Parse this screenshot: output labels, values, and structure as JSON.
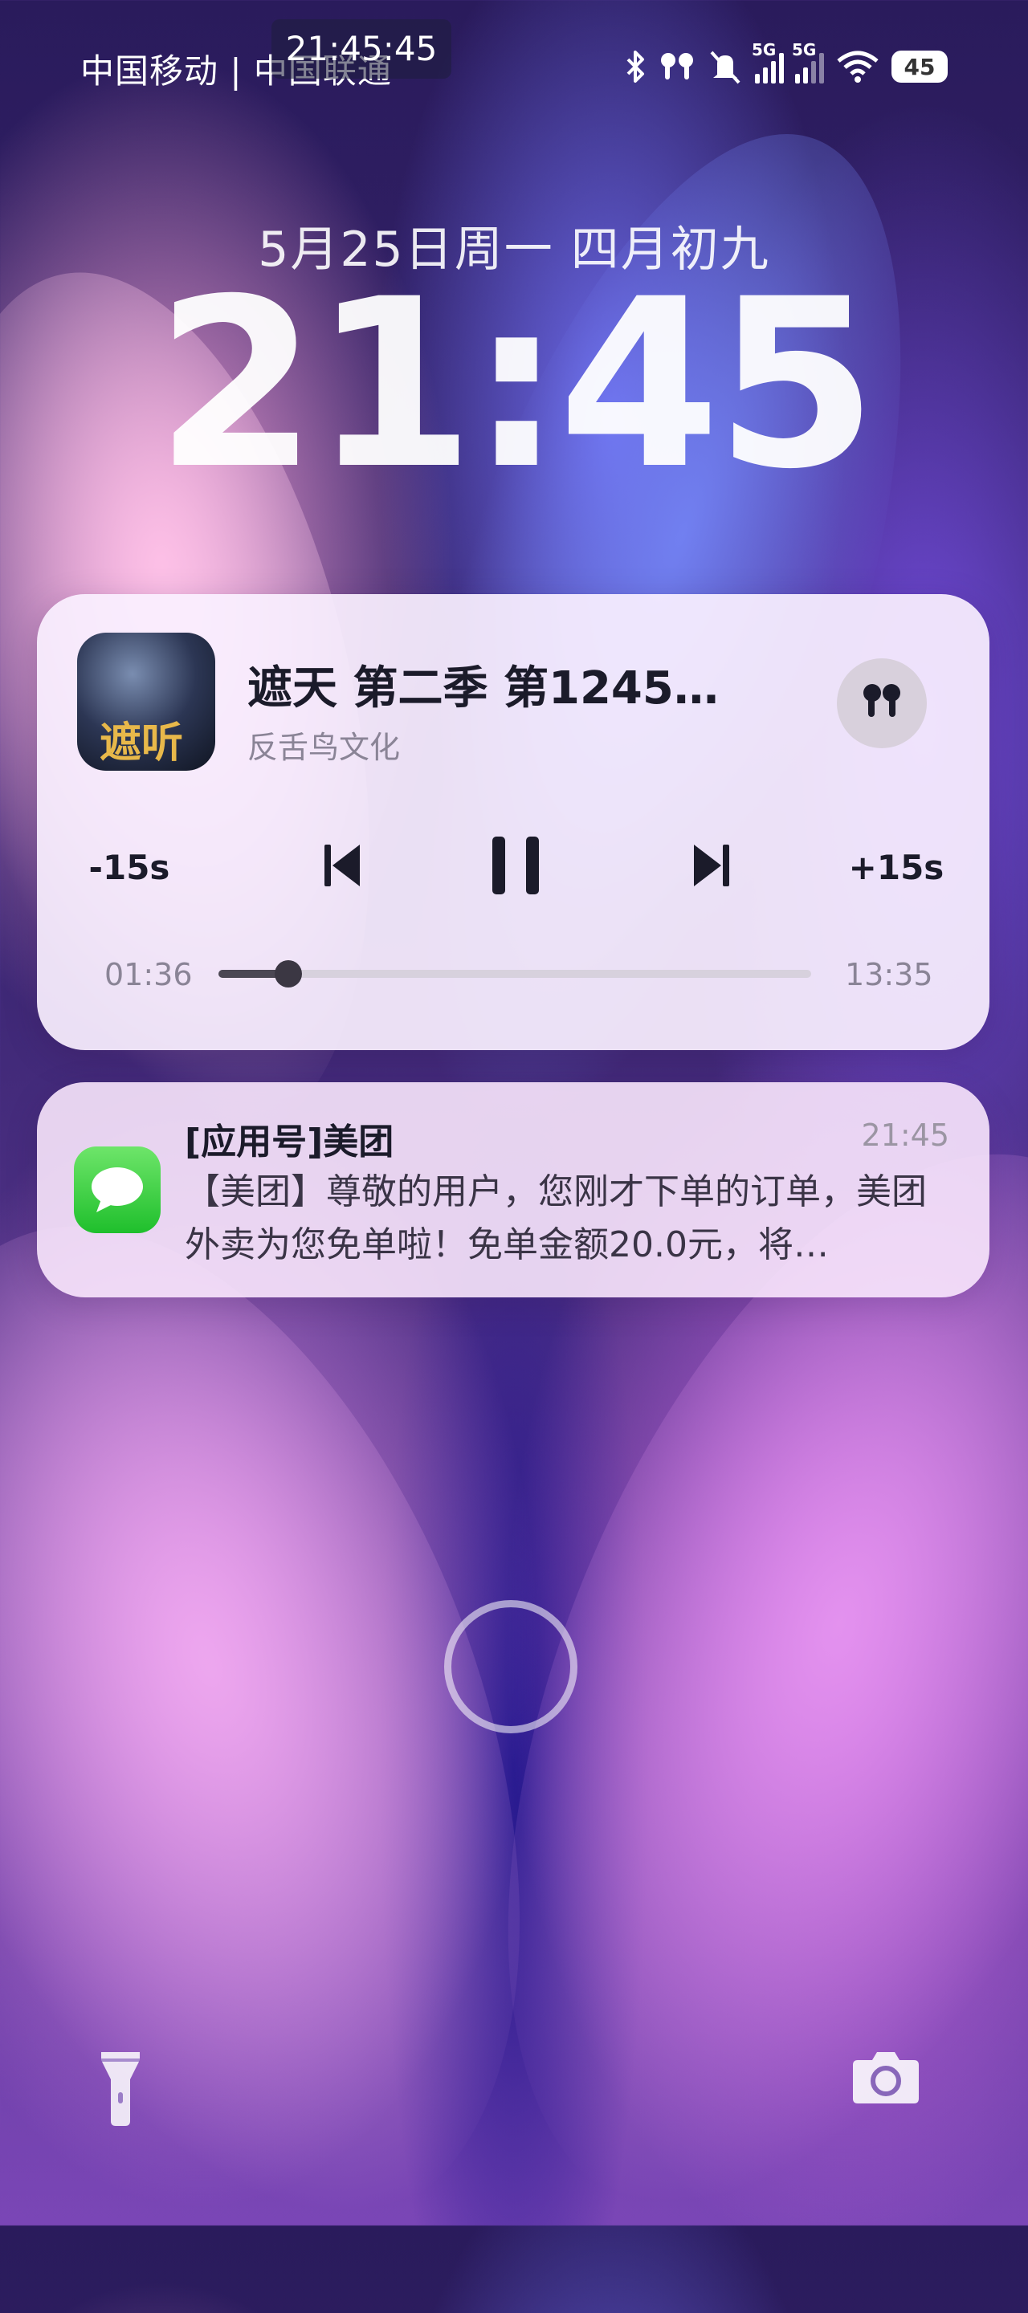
{
  "status_bar": {
    "carrier": "中国移动 | 中国联通",
    "time_overlay": "21:45:45",
    "network_label_1": "5G",
    "network_label_2": "5G",
    "battery": "45"
  },
  "lock_screen": {
    "date": "5月25日周一 四月初九",
    "clock": "21:45"
  },
  "media_player": {
    "album_art_text": "遮听",
    "title": "遮天 第二季 第1245集…",
    "artist": "反舌鸟文化",
    "rewind_label": "-15s",
    "forward_label": "+15s",
    "elapsed": "01:36",
    "duration": "13:35",
    "progress": 0.118,
    "output_device_icon": "earbuds-icon"
  },
  "notification": {
    "app": "[应用号]美团",
    "time": "21:45",
    "body": "【美团】尊敬的用户，您刚才下单的订单，美团外卖为您免单啦！免单金额20.0元，将…"
  },
  "bottom": {
    "left_icon": "flashlight-icon",
    "right_icon": "camera-icon",
    "center_icon": "fingerprint-ring-icon"
  }
}
